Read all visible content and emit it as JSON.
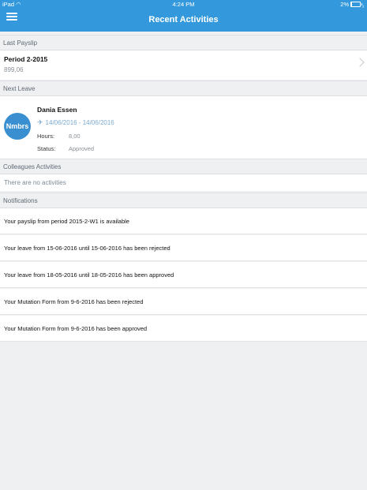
{
  "status_bar": {
    "device": "iPad",
    "wifi_icon": "wifi-icon",
    "time": "4:24 PM",
    "battery": "2%",
    "battery_level": 0.02
  },
  "header": {
    "title": "Recent Activities",
    "menu_icon": "hamburger-menu-icon",
    "color": "#3499dc"
  },
  "last_payslip": {
    "section_label": "Last Payslip",
    "period": "Period 2-2015",
    "amount": "899,06"
  },
  "next_leave": {
    "section_label": "Next Leave",
    "avatar_text": "Nmbrs",
    "name": "Dania Essen",
    "dates": "14/06/2016 - 14/06/2016",
    "hours_label": "Hours:",
    "hours_value": "8,00",
    "status_label": "Status:",
    "status_value": "Approved"
  },
  "colleagues": {
    "section_label": "Colleagues Activities",
    "empty_text": "There are no activities"
  },
  "notifications": {
    "section_label": "Notifications",
    "items": [
      "Your payslip from period 2015-2-W1 is available",
      "Your leave from 15-06-2016 until 15-06-2016 has been rejected",
      "Your leave from 18-05-2016 until 18-05-2016 has been approved",
      "Your Mutation Form  from 9-6-2016 has been rejected",
      "Your Mutation Form  from 9-6-2016 has been approved"
    ]
  }
}
